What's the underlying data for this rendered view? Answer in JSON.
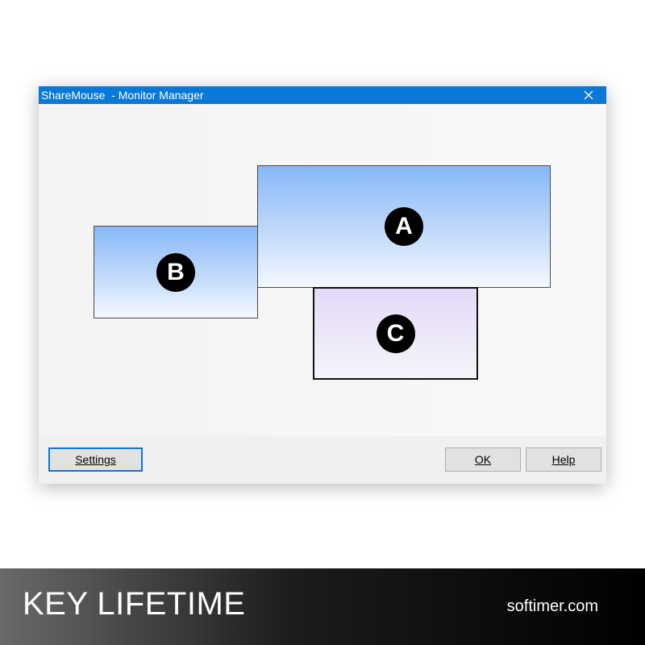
{
  "window": {
    "title": "ShareMouse  - Monitor Manager",
    "close_icon": "close-icon"
  },
  "monitors": [
    {
      "id": "A",
      "label": "A",
      "style": "blue"
    },
    {
      "id": "B",
      "label": "B",
      "style": "blue"
    },
    {
      "id": "C",
      "label": "C",
      "style": "violet"
    }
  ],
  "buttons": {
    "settings": "Settings",
    "ok": "OK",
    "help": "Help"
  },
  "footer": {
    "left_text": "KEY LIFETIME",
    "right_text": "softimer.com"
  },
  "colors": {
    "titlebar": "#0a78d7",
    "monitor_blue_top": "#87b8f8",
    "monitor_violet_top": "#e4d9f8"
  }
}
